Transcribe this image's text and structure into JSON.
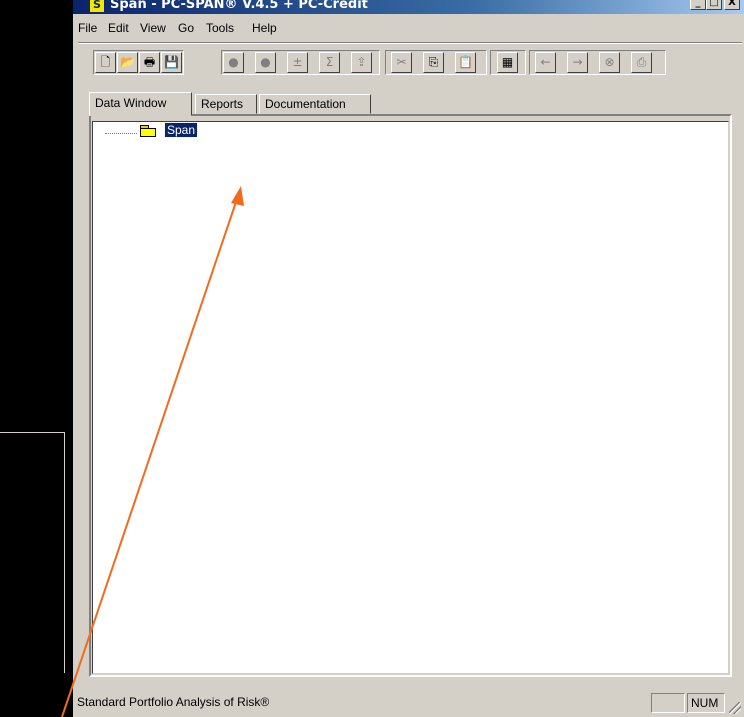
{
  "window": {
    "title": "Span - PC-SPAN® V.4.5 + PC-Credit",
    "icon_letter": "S",
    "controls": {
      "minimize": "_",
      "maximize": "□",
      "close": "X"
    }
  },
  "menu": [
    "File",
    "Edit",
    "View",
    "Go",
    "Tools",
    "Help"
  ],
  "toolbar": {
    "buttons": [
      {
        "name": "new-document-icon",
        "glyph": "🗋"
      },
      {
        "name": "open-folder-icon",
        "glyph": "📂"
      },
      {
        "name": "print-preview-icon",
        "glyph": "🖶"
      },
      {
        "name": "save-icon",
        "glyph": "💾"
      },
      {
        "name": "circle-one-icon",
        "glyph": "●"
      },
      {
        "name": "circle-two-icon",
        "glyph": "●"
      },
      {
        "name": "plus-minus-icon",
        "glyph": "±"
      },
      {
        "name": "sigma-icon",
        "glyph": "Σ"
      },
      {
        "name": "export-icon",
        "glyph": "⇪"
      },
      {
        "name": "cut-icon",
        "glyph": "✂"
      },
      {
        "name": "copy-icon",
        "glyph": "⎘"
      },
      {
        "name": "paste-icon",
        "glyph": "📋"
      },
      {
        "name": "calculator-icon",
        "glyph": "▦"
      },
      {
        "name": "back-arrow-icon",
        "glyph": "←"
      },
      {
        "name": "forward-arrow-icon",
        "glyph": "→"
      },
      {
        "name": "stop-icon",
        "glyph": "⊗"
      },
      {
        "name": "print-icon",
        "glyph": "⎙"
      }
    ]
  },
  "tabs": [
    "Data Window",
    "Reports",
    "Documentation"
  ],
  "tree": {
    "root_label": "Span"
  },
  "status": {
    "text": "Standard Portfolio Analysis of Risk®",
    "num_indicator": "NUM"
  },
  "annotation": {
    "arrow_color": "#f26b1d"
  }
}
